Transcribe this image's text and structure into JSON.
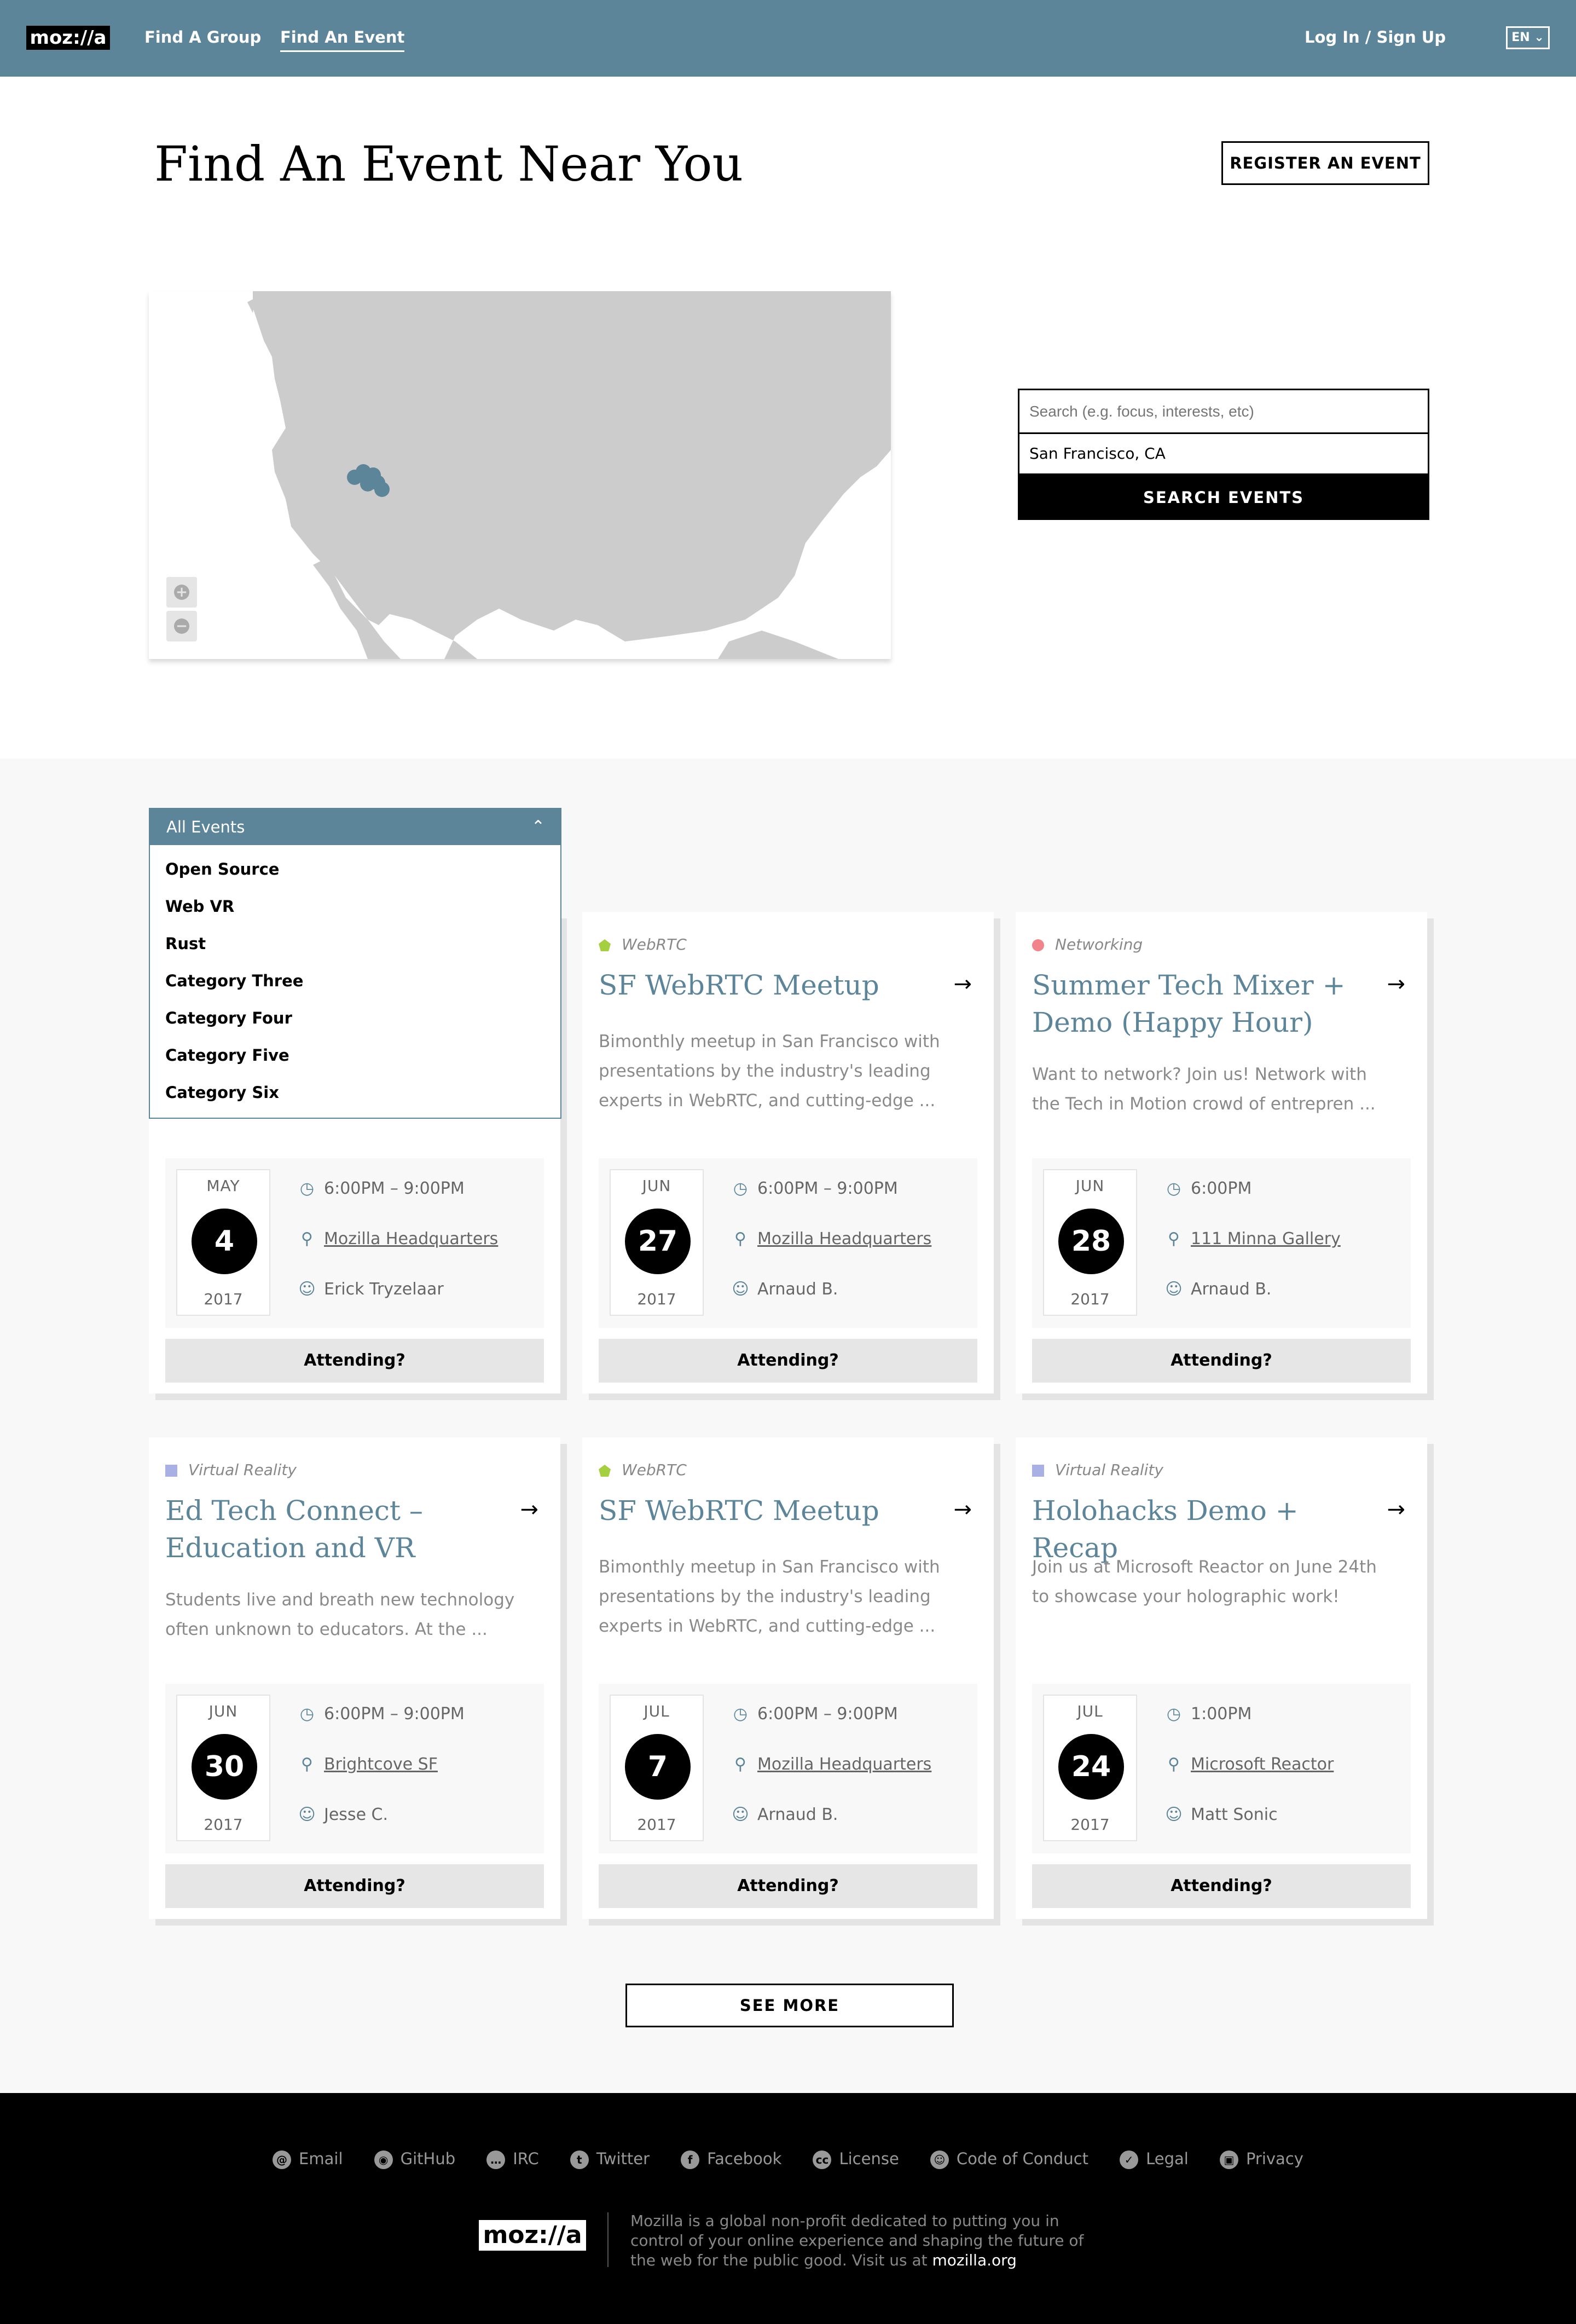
{
  "header": {
    "logo": "moz://a",
    "nav": [
      {
        "label": "Find A Group"
      },
      {
        "label": "Find An Event"
      }
    ],
    "login": "Log In / Sign Up",
    "lang": "EN"
  },
  "hero": {
    "title": "Find An Event Near You",
    "register_label": "REGISTER AN EVENT"
  },
  "search": {
    "placeholder": "Search (e.g. focus, interests, etc)",
    "location_value": "San Francisco, CA",
    "button_label": "SEARCH EVENTS"
  },
  "filter": {
    "selected": "All Events",
    "options": [
      "Open Source",
      "Web VR",
      "Rust",
      "Category Three",
      "Category Four",
      "Category Five",
      "Category Six"
    ]
  },
  "events": [
    {
      "category": "",
      "title": "",
      "desc": "",
      "month": "MAY",
      "day": "4",
      "year": "2017",
      "time": "6:00PM – 9:00PM",
      "location": "Mozilla Headquarters",
      "host": "Erick Tryzelaar",
      "cta": "Attending?",
      "cat_color": "#ffffff"
    },
    {
      "category": "WebRTC",
      "title": "SF WebRTC Meetup",
      "desc": "Bimonthly meetup in San Francisco with presentations by the industry's leading experts in WebRTC, and cutting-edge ...",
      "month": "JUN",
      "day": "27",
      "year": "2017",
      "time": "6:00PM – 9:00PM",
      "location": "Mozilla Headquarters",
      "host": "Arnaud B.",
      "cta": "Attending?",
      "cat_color": "#a6cf3f"
    },
    {
      "category": "Networking",
      "title": "Summer Tech Mixer + Demo (Happy Hour)",
      "desc": "Want to network?  Join us! Network with the Tech in Motion crowd of entrepren ...",
      "month": "JUN",
      "day": "28",
      "year": "2017",
      "time": "6:00PM",
      "location": "111 Minna Gallery",
      "host": "Arnaud B.",
      "cta": "Attending?",
      "cat_color": "#f0848a"
    },
    {
      "category": "Virtual Reality",
      "title": "Ed Tech Connect – Education and VR",
      "desc": "Students live and breath new technology often unknown to educators. At the ...",
      "month": "JUN",
      "day": "30",
      "year": "2017",
      "time": "6:00PM – 9:00PM",
      "location": "Brightcove SF",
      "host": "Jesse C.",
      "cta": "Attending?",
      "cat_color": "#a9b0e3"
    },
    {
      "category": "WebRTC",
      "title": "SF WebRTC Meetup",
      "desc": "Bimonthly meetup in San Francisco with presentations by the industry's leading experts in WebRTC, and cutting-edge ...",
      "month": "JUL",
      "day": "7",
      "year": "2017",
      "time": "6:00PM – 9:00PM",
      "location": "Mozilla Headquarters",
      "host": "Arnaud B.",
      "cta": "Attending?",
      "cat_color": "#a6cf3f"
    },
    {
      "category": "Virtual Reality",
      "title": "Holohacks Demo + Recap",
      "desc": "Join us at Microsoft Reactor on June 24th to showcase your holographic work!",
      "month": "JUL",
      "day": "24",
      "year": "2017",
      "time": "1:00PM",
      "location": "Microsoft Reactor",
      "host": "Matt Sonic",
      "cta": "Attending?",
      "cat_color": "#a9b0e3"
    }
  ],
  "see_more": "SEE MORE",
  "footer": {
    "links": [
      "Email",
      "GitHub",
      "IRC",
      "Twitter",
      "Facebook",
      "License",
      "Code of Conduct",
      "Legal",
      "Privacy"
    ],
    "logo": "moz://a",
    "about": "Mozilla is a global non-profit dedicated to putting you in control of your online experience and shaping the future of the web for the public good. Visit us at",
    "site": "mozilla.org"
  },
  "colors": {
    "brand": "#5c8599",
    "map_land": "#cccccc"
  }
}
